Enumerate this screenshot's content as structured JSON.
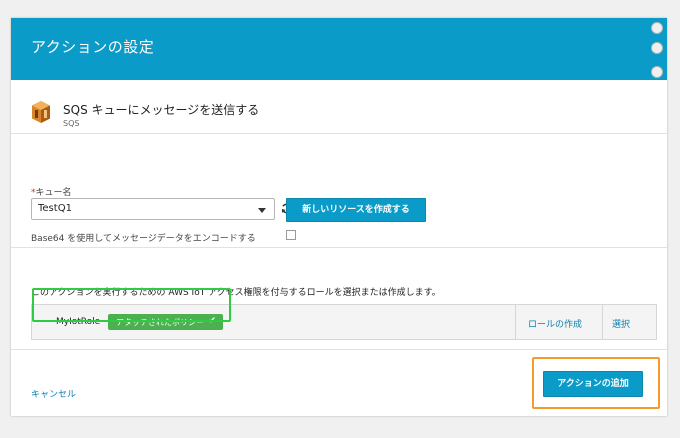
{
  "dialog": {
    "title": "アクションの設定"
  },
  "action": {
    "icon": "sqs-service-icon",
    "title": "SQS キューにメッセージを送信する",
    "subtitle": "SQS"
  },
  "queue": {
    "required_mark": "*",
    "label": "キュー名",
    "selected_value": "TestQ1",
    "refresh_icon": "refresh-icon",
    "create_button_label": "新しいリソースを作成する"
  },
  "base64": {
    "label": "Base64 を使用してメッセージデータをエンコードする",
    "checked": false
  },
  "role": {
    "description": "このアクションを実行するための AWS IoT アクセス権限を付与するロールを選択または作成します。",
    "selected_role": "MyIotRole",
    "policy_badge": "アタッチされたポリシー",
    "policy_badge_icon": "check-icon",
    "create_role_label": "ロールの作成",
    "select_label": "選択"
  },
  "footer": {
    "cancel_label": "キャンセル",
    "add_action_label": "アクションの追加"
  },
  "colors": {
    "primary": "#0a9bc8",
    "success": "#4caf50",
    "highlight_green": "#2ecc40",
    "highlight_orange": "#f39c2c",
    "link": "#0a7fb0"
  }
}
